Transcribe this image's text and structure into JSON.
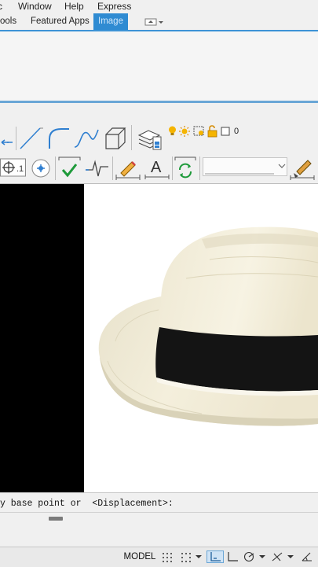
{
  "menubar": {
    "items": [
      {
        "label": "c"
      },
      {
        "label": "Window"
      },
      {
        "label": "Help"
      },
      {
        "label": "Express"
      }
    ]
  },
  "ribbon_tabs": {
    "tabs": [
      {
        "label": "ools",
        "active": false
      },
      {
        "label": "Featured Apps",
        "active": false
      },
      {
        "label": "Image",
        "active": true
      }
    ]
  },
  "toolbar": {
    "layer_count": "0",
    "accent": "#2f8bd2"
  },
  "command_line": {
    "text": "y base point or  <Displacement>:"
  },
  "statusbar": {
    "model_label": "MODEL"
  }
}
